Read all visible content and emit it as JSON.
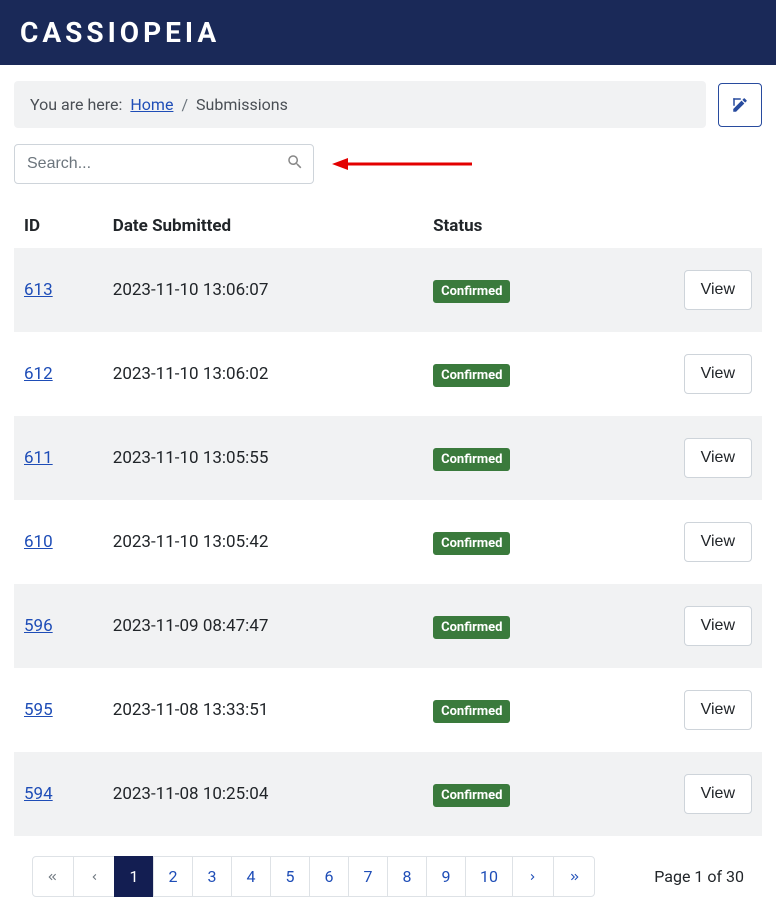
{
  "header": {
    "logo": "CASSIOPEIA"
  },
  "breadcrumb": {
    "prefix": "You are here:",
    "home": "Home",
    "sep": "/",
    "current": "Submissions"
  },
  "search": {
    "placeholder": "Search..."
  },
  "table": {
    "headers": {
      "id": "ID",
      "date": "Date Submitted",
      "status": "Status"
    },
    "rows": [
      {
        "id": "613",
        "date": "2023-11-10 13:06:07",
        "status": "Confirmed",
        "action": "View"
      },
      {
        "id": "612",
        "date": "2023-11-10 13:06:02",
        "status": "Confirmed",
        "action": "View"
      },
      {
        "id": "611",
        "date": "2023-11-10 13:05:55",
        "status": "Confirmed",
        "action": "View"
      },
      {
        "id": "610",
        "date": "2023-11-10 13:05:42",
        "status": "Confirmed",
        "action": "View"
      },
      {
        "id": "596",
        "date": "2023-11-09 08:47:47",
        "status": "Confirmed",
        "action": "View"
      },
      {
        "id": "595",
        "date": "2023-11-08 13:33:51",
        "status": "Confirmed",
        "action": "View"
      },
      {
        "id": "594",
        "date": "2023-11-08 10:25:04",
        "status": "Confirmed",
        "action": "View"
      }
    ]
  },
  "pagination": {
    "pages": [
      "1",
      "2",
      "3",
      "4",
      "5",
      "6",
      "7",
      "8",
      "9",
      "10"
    ],
    "active": "1",
    "info": "Page 1 of 30"
  }
}
